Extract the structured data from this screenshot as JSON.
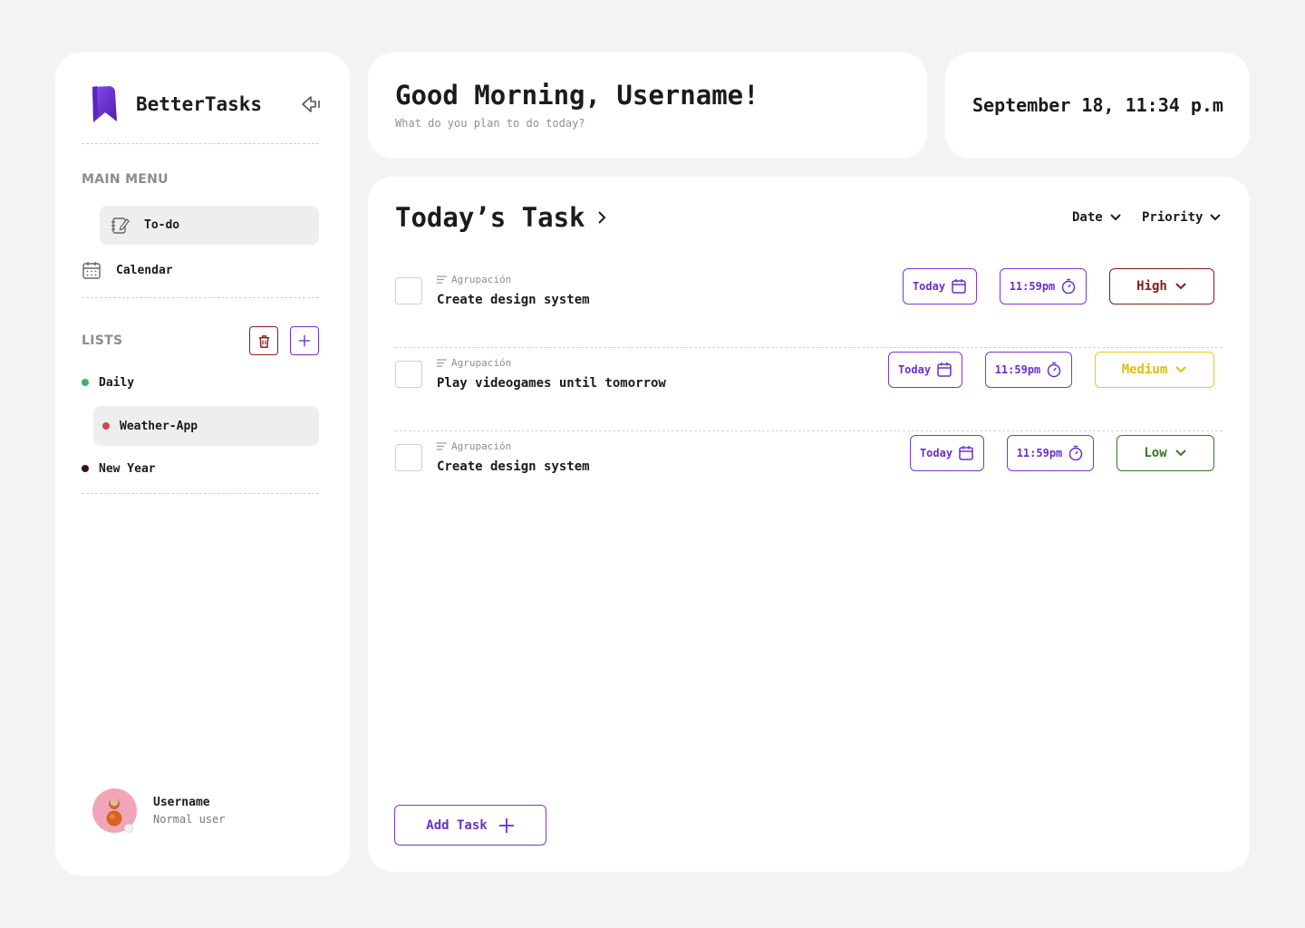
{
  "app": {
    "name": "BetterTasks"
  },
  "sidebar": {
    "main_menu_title": "MAIN MENU",
    "menu_items": [
      {
        "label": "To-do",
        "icon": "notebook-edit-icon",
        "active": true
      },
      {
        "label": "Calendar",
        "icon": "calendar-icon",
        "active": false
      }
    ],
    "lists_title": "LISTS",
    "lists": [
      {
        "label": "Daily",
        "color": "#3bb36a",
        "active": false
      },
      {
        "label": "Weather-App",
        "color": "#d54545",
        "active": true
      },
      {
        "label": "New Year",
        "color": "#3a0f24",
        "active": false
      }
    ],
    "user": {
      "name": "Username",
      "role": "Normal user"
    }
  },
  "header": {
    "greeting": "Good Morning, Username!",
    "subtitle": "What do you plan to do today?",
    "datetime": "September 18, 11:34 p.m"
  },
  "tasks_panel": {
    "title": "Today’s Task",
    "filters": [
      "Date",
      "Priority"
    ],
    "tasks": [
      {
        "group": "Agrupación",
        "name": "Create design system",
        "date": "Today",
        "time": "11:59pm",
        "priority": "High"
      },
      {
        "group": "Agrupación",
        "name": "Play videogames until tomorrow",
        "date": "Today",
        "time": "11:59pm",
        "priority": "Medium"
      },
      {
        "group": "Agrupación",
        "name": "Create design system",
        "date": "Today",
        "time": "11:59pm",
        "priority": "Low"
      }
    ],
    "add_label": "Add Task"
  },
  "colors": {
    "accent": "#6a2fd1",
    "priority_high": "#8b1a1a",
    "priority_medium": "#e3bc0a",
    "priority_low": "#2f7d1e"
  }
}
